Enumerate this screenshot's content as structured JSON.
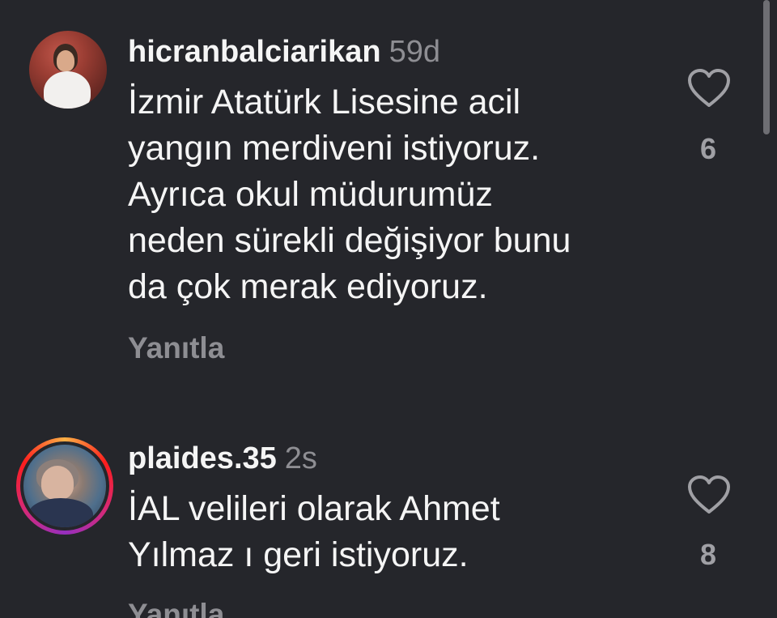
{
  "comments": [
    {
      "username": "hicranbalciarikan",
      "time": "59d",
      "text": "İzmir Atatürk Lisesine acil\nyangın merdiveni istiyoruz.\nAyrıca okul müdurumüz\nneden sürekli değişiyor bunu\nda çok merak ediyoruz.",
      "reply_label": "Yanıtla",
      "likes": "6"
    },
    {
      "username": "plaides.35",
      "time": "2s",
      "text": "İAL velileri olarak Ahmet\nYılmaz ı geri istiyoruz.",
      "reply_label": "Yanıtla",
      "likes": "8"
    }
  ],
  "icons": {
    "like": "heart-outline-icon"
  },
  "colors": {
    "background": "#25262b",
    "text_primary": "#f5f5f5",
    "text_secondary": "#8e8e93",
    "story_ring": [
      "#fcb045",
      "#fd1d1d",
      "#d62976",
      "#962fbf"
    ]
  }
}
